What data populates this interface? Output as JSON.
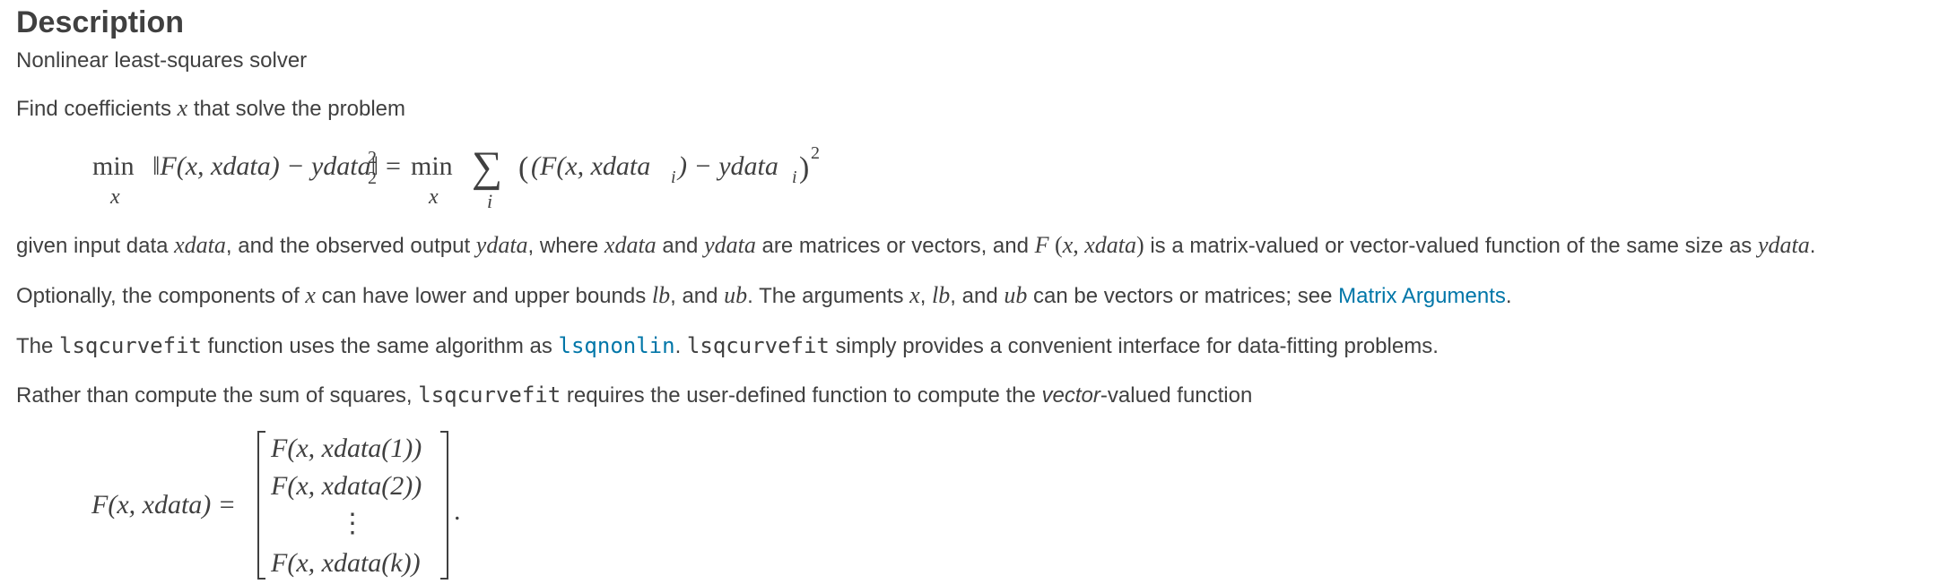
{
  "heading": "Description",
  "subtitle": "Nonlinear least-squares solver",
  "intro": {
    "before": "Find coefficients ",
    "var": "x",
    "after": " that solve the problem"
  },
  "eq1": {
    "min1": "min",
    "sub1": "x",
    "lhs": "‖F(x, xdata) − ydata‖",
    "sup": "2",
    "sub": "2",
    "eq": "=",
    "min2": "min",
    "sub2": "x",
    "sigma": "∑",
    "sigma_sub": "i",
    "rhs": "(F(x, xdata",
    "rhs_i1": "i",
    "rhs2": ") − ydata",
    "rhs_i2": "i",
    "rhs3": ")",
    "rhs_sup": "2",
    "rhs_end": ","
  },
  "given": {
    "t1": "given input data ",
    "v1": "xdata",
    "t2": ", and the observed output ",
    "v2": "ydata",
    "t3": ", where ",
    "v3": "xdata",
    "t4": " and ",
    "v4": "ydata",
    "t5": " are matrices or vectors, and ",
    "v5": "F",
    "v5b": " (",
    "v5c": "x",
    "v5d": ", ",
    "v5e": "xdata",
    "v5f": ")",
    "t6": " is a matrix-valued or vector-valued function of the same size as ",
    "v6": "ydata",
    "t7": "."
  },
  "optional": {
    "t1": "Optionally, the components of ",
    "v1": "x",
    "t2": " can have lower and upper bounds ",
    "v2": "lb",
    "t3": ", and ",
    "v3": "ub",
    "t4": ". The arguments ",
    "v4": "x",
    "t5": ", ",
    "v5": "lb",
    "t6": ", and ",
    "v6": "ub",
    "t7": " can be vectors or matrices; see ",
    "link": "Matrix Arguments",
    "t8": "."
  },
  "algo": {
    "t1": "The ",
    "c1": "lsqcurvefit",
    "t2": " function uses the same algorithm as ",
    "link": "lsqnonlin",
    "t3": ". ",
    "c2": "lsqcurvefit",
    "t4": " simply provides a convenient interface for data-fitting problems."
  },
  "rather": {
    "t1": "Rather than compute the sum of squares, ",
    "c1": "lsqcurvefit",
    "t2": " requires the user-defined function to compute the ",
    "em": "vector",
    "t3": "-valued function"
  },
  "eq2": {
    "lhs": "F(x, xdata) =",
    "row1": "F(x, xdata(1))",
    "row2": "F(x, xdata(2))",
    "row3": "⋮",
    "row4": "F(x, xdata(k))",
    "end": "."
  }
}
